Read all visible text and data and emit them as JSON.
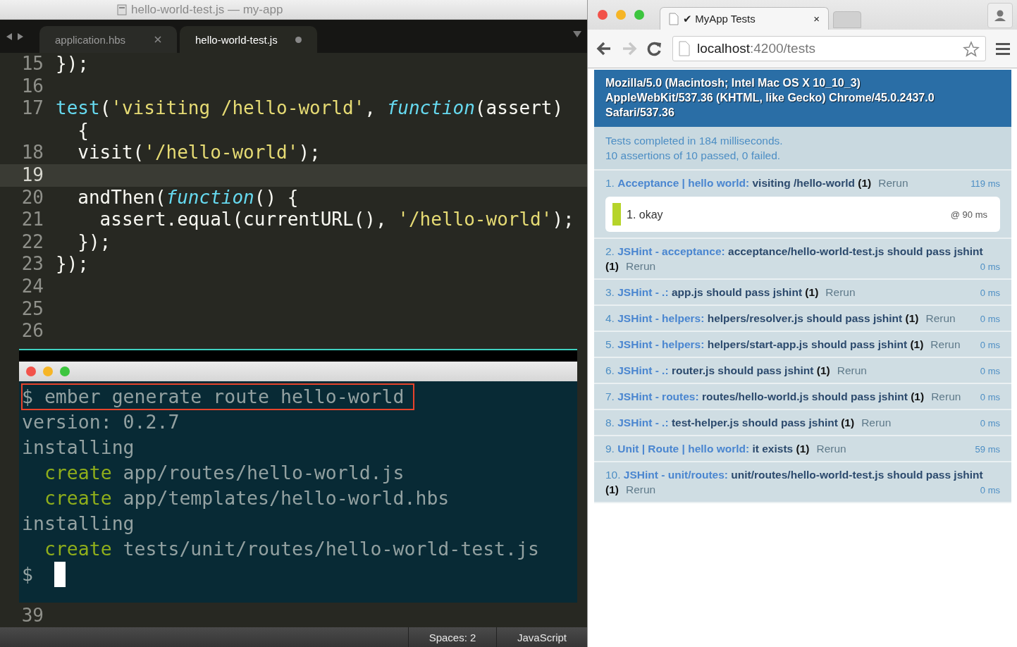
{
  "editor": {
    "title": "hello-world-test.js — my-app",
    "tabs": [
      {
        "label": "application.hbs",
        "selected": false,
        "modified": false
      },
      {
        "label": "hello-world-test.js",
        "selected": true,
        "modified": true
      }
    ],
    "lines": [
      {
        "number": "15",
        "current": false,
        "tokens": [
          {
            "kind": "plain",
            "text": "});"
          }
        ]
      },
      {
        "number": "16",
        "current": false
      },
      {
        "number": "17",
        "current": false,
        "tokens": [
          {
            "kind": "builtin",
            "text": "test"
          },
          {
            "kind": "plain",
            "text": "("
          },
          {
            "kind": "string",
            "text": "'visiting /hello-world'"
          },
          {
            "kind": "plain",
            "text": ", "
          },
          {
            "kind": "keyword",
            "text": "function"
          },
          {
            "kind": "plain",
            "text": "(assert)"
          }
        ]
      },
      {
        "current": false,
        "tokens": [
          {
            "kind": "plain",
            "text": "  {"
          }
        ]
      },
      {
        "number": "18",
        "current": false,
        "tokens": [
          {
            "kind": "plain",
            "text": "  visit("
          },
          {
            "kind": "string",
            "text": "'/hello-world'"
          },
          {
            "kind": "plain",
            "text": ");"
          }
        ]
      },
      {
        "number": "19",
        "current": true
      },
      {
        "number": "20",
        "current": false,
        "tokens": [
          {
            "kind": "plain",
            "text": "  andThen("
          },
          {
            "kind": "keyword",
            "text": "function"
          },
          {
            "kind": "plain",
            "text": "() {"
          }
        ]
      },
      {
        "number": "21",
        "current": false,
        "tokens": [
          {
            "kind": "plain",
            "text": "    assert.equal(currentURL(), "
          },
          {
            "kind": "string",
            "text": "'/hello-world'"
          },
          {
            "kind": "plain",
            "text": ");"
          }
        ]
      },
      {
        "number": "22",
        "current": false,
        "tokens": [
          {
            "kind": "plain",
            "text": "  });"
          }
        ]
      },
      {
        "number": "23",
        "current": false,
        "tokens": [
          {
            "kind": "plain",
            "text": "});"
          }
        ]
      },
      {
        "number": "24",
        "current": false
      },
      {
        "number": "25",
        "current": false
      },
      {
        "number": "26",
        "current": false
      }
    ],
    "footer_lines": [
      {
        "number": "39",
        "current": false
      }
    ],
    "status_bar": [
      "Spaces: 2",
      "JavaScript"
    ]
  },
  "terminal": {
    "lines": [
      {
        "kind": "command",
        "text": "$ ember generate route hello-world",
        "highlighted": true
      },
      {
        "kind": "output",
        "text": "version: 0.2.7",
        "highlighted": false
      },
      {
        "kind": "output",
        "text": "installing",
        "highlighted": false
      },
      {
        "kind": "create",
        "action": "create",
        "text": "app/routes/hello-world.js",
        "highlighted": false
      },
      {
        "kind": "create",
        "action": "create",
        "text": "app/templates/hello-world.hbs",
        "highlighted": false
      },
      {
        "kind": "output",
        "text": "installing",
        "highlighted": false
      },
      {
        "kind": "create",
        "action": "create",
        "text": "tests/unit/routes/hello-world-test.js",
        "highlighted": false
      },
      {
        "kind": "prompt",
        "text": "$",
        "highlighted": false
      }
    ]
  },
  "browser": {
    "tab": {
      "title": "✔ MyApp Tests",
      "close": "×"
    },
    "nav": [
      {
        "kind": "back",
        "disabled": false
      },
      {
        "kind": "forward",
        "disabled": true
      },
      {
        "kind": "reload",
        "disabled": false
      }
    ],
    "url": {
      "host": "localhost",
      "path": ":4200/tests"
    },
    "qunit": {
      "user_agent_lines": [
        "Mozilla/5.0 (Macintosh; Intel Mac OS X 10_10_3)",
        "AppleWebKit/537.36 (KHTML, like Gecko) Chrome/45.0.2437.0",
        "Safari/537.36"
      ],
      "result_lines": [
        "Tests completed in 184 milliseconds.",
        "10 assertions of 10 passed, 0 failed."
      ],
      "tests": [
        {
          "number": "1.",
          "module": "Acceptance | hello world:",
          "name": "visiting /hello-world",
          "count": "(1)",
          "rerun": "Rerun",
          "time": "119 ms",
          "assertions": [
            {
              "text": "1. okay",
              "time": "@ 90 ms"
            }
          ]
        },
        {
          "number": "2.",
          "module": "JSHint - acceptance:",
          "name": "acceptance/hello-world-test.js should pass jshint",
          "count": "(1)",
          "rerun": "Rerun",
          "time": "0 ms"
        },
        {
          "number": "3.",
          "module": "JSHint - .:",
          "name": "app.js should pass jshint",
          "count": "(1)",
          "rerun": "Rerun",
          "time": "0 ms"
        },
        {
          "number": "4.",
          "module": "JSHint - helpers:",
          "name": "helpers/resolver.js should pass jshint",
          "count": "(1)",
          "rerun": "Rerun",
          "time": "0 ms"
        },
        {
          "number": "5.",
          "module": "JSHint - helpers:",
          "name": "helpers/start-app.js should pass jshint",
          "count": "(1)",
          "rerun": "Rerun",
          "time": "0 ms"
        },
        {
          "number": "6.",
          "module": "JSHint - .:",
          "name": "router.js should pass jshint",
          "count": "(1)",
          "rerun": "Rerun",
          "time": "0 ms"
        },
        {
          "number": "7.",
          "module": "JSHint - routes:",
          "name": "routes/hello-world.js should pass jshint",
          "count": "(1)",
          "rerun": "Rerun",
          "time": "0 ms"
        },
        {
          "number": "8.",
          "module": "JSHint - .:",
          "name": "test-helper.js should pass jshint",
          "count": "(1)",
          "rerun": "Rerun",
          "time": "0 ms"
        },
        {
          "number": "9.",
          "module": "Unit | Route | hello world:",
          "name": "it exists",
          "count": "(1)",
          "rerun": "Rerun",
          "time": "59 ms"
        },
        {
          "number": "10.",
          "module": "JSHint - unit/routes:",
          "name": "unit/routes/hello-world-test.js should pass jshint",
          "count": "(1)",
          "rerun": "Rerun",
          "time": "0 ms"
        }
      ]
    }
  }
}
